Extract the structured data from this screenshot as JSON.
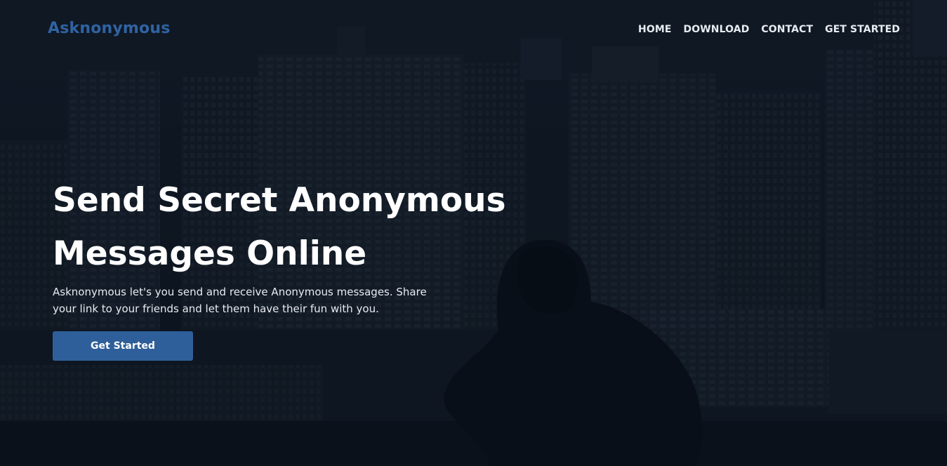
{
  "brand": {
    "name": "Asknonymous"
  },
  "nav": {
    "items": [
      {
        "label": "HOME"
      },
      {
        "label": "DOWNLOAD"
      },
      {
        "label": "CONTACT"
      },
      {
        "label": "GET STARTED"
      }
    ]
  },
  "hero": {
    "headline": "Send Secret Anonymous Messages Online",
    "description": "Asknonymous let's you send and receive Anonymous messages. Share your link to your friends and let them have their fun with you.",
    "button_label": "Get Started"
  },
  "colors": {
    "brand": "#2f63a3",
    "button": "#2f5f9a",
    "nav_text": "#e8ecf2",
    "headline": "#ffffff",
    "background": "#0f1622"
  }
}
